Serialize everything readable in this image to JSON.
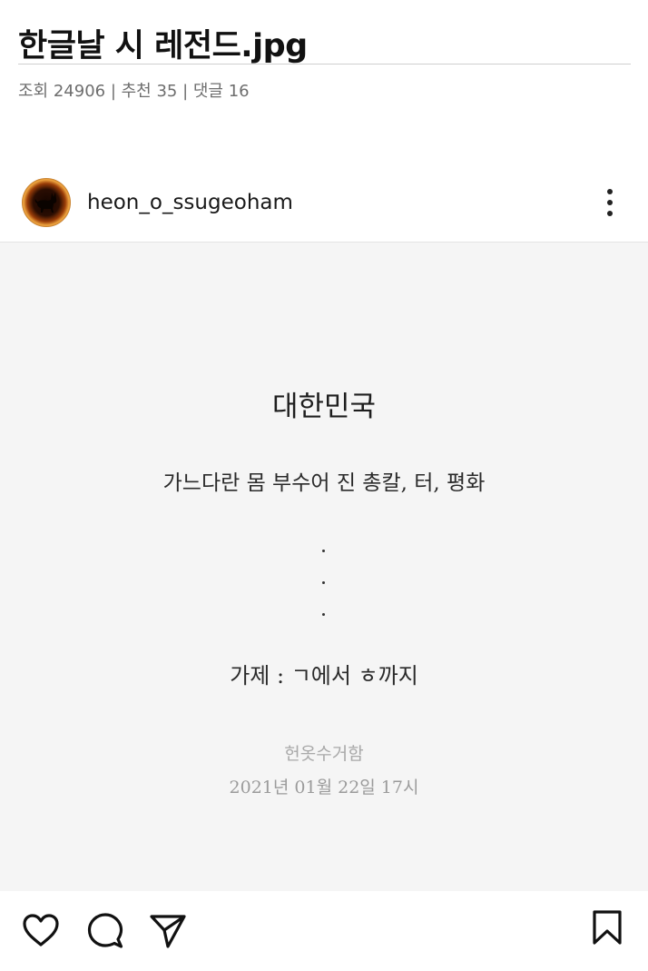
{
  "post": {
    "title": "한글날 시 레전드.jpg",
    "stats": "조회 24906 | 추천 35 | 댓글 16"
  },
  "instagram": {
    "username": "heon_o_ssugeoham",
    "avatar_icon": "cat-silhouette-icon",
    "menu_icon": "more-vertical-icon"
  },
  "poem": {
    "title": "대한민국",
    "line": "가느다란 몸 부수어 진 총칼, 터, 평화",
    "answer": "가제 : ㄱ에서 ㅎ까지",
    "author": "헌옷수거함",
    "date": "2021년 01월 22일 17시"
  },
  "actions": {
    "icons": [
      "heart-icon",
      "comment-icon",
      "send-icon",
      "bookmark-icon"
    ]
  },
  "colors": {
    "image_background": "#f5f5f5",
    "stats_text": "#6e6e6e",
    "author_text": "#a9a9a9"
  }
}
